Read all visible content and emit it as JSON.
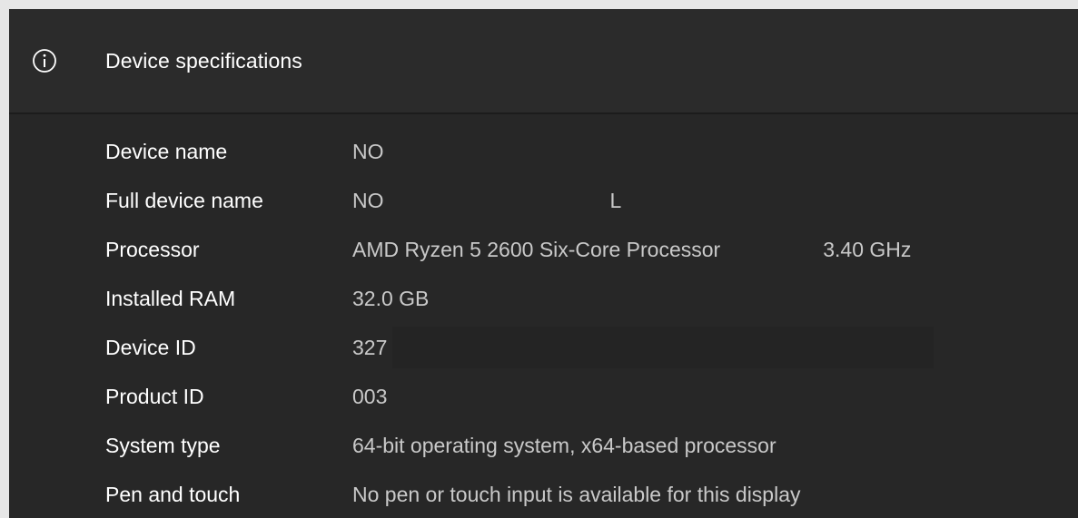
{
  "header": {
    "icon": "info-icon",
    "title": "Device specifications"
  },
  "specs": [
    {
      "label": "Device name",
      "value": "NO"
    },
    {
      "label": "Full device name",
      "value": "NO",
      "extra": "L"
    },
    {
      "label": "Processor",
      "value": "AMD Ryzen 5 2600 Six-Core Processor",
      "extra": "3.40 GHz"
    },
    {
      "label": "Installed RAM",
      "value": "32.0 GB"
    },
    {
      "label": "Device ID",
      "value": "327"
    },
    {
      "label": "Product ID",
      "value": "003"
    },
    {
      "label": "System type",
      "value": "64-bit operating system, x64-based processor"
    },
    {
      "label": "Pen and touch",
      "value": "No pen or touch input is available for this display"
    }
  ],
  "colors": {
    "panel": "#272727",
    "header": "#2b2b2b",
    "label_text": "#ffffff",
    "value_text": "#c9c9c9"
  }
}
